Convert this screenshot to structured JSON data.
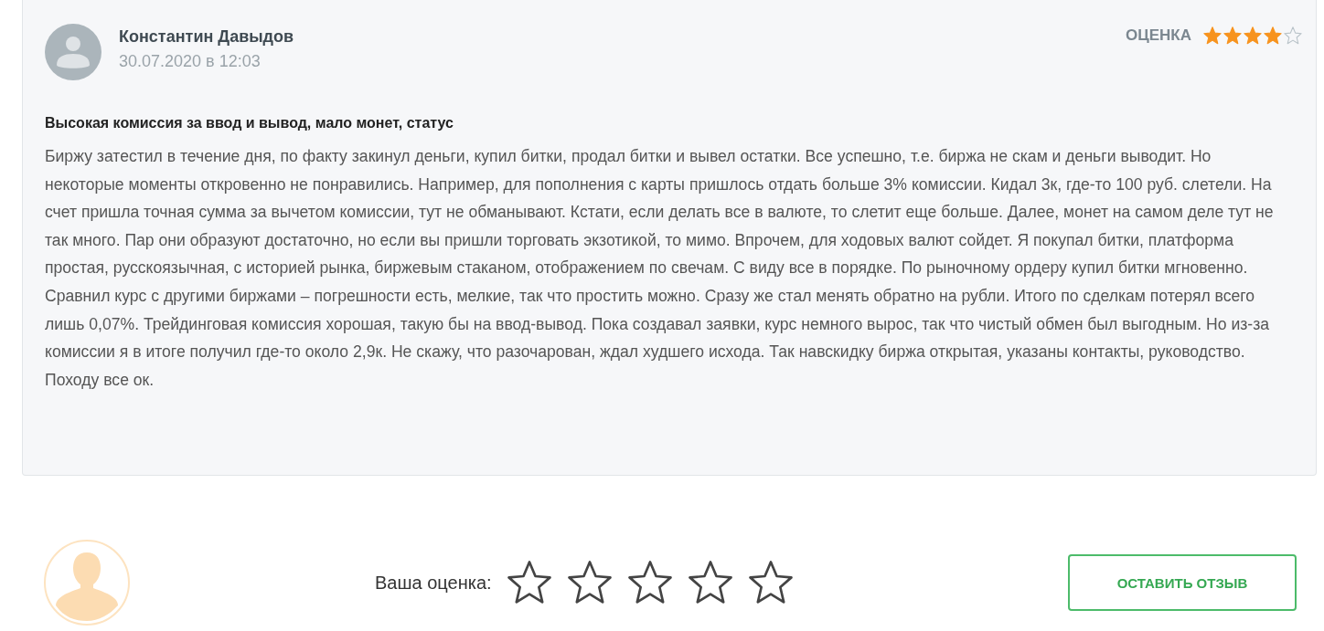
{
  "review": {
    "author": "Константин Давыдов",
    "date": "30.07.2020 в 12:03",
    "rating_label": "ОЦЕНКА",
    "stars": 4,
    "title": "Высокая комиссия за ввод и вывод, мало монет, статус",
    "text": "Биржу затестил в течение дня, по факту закинул деньги, купил битки, продал битки и вывел остатки. Все успешно, т.е. биржа не скам и деньги выводит. Но некоторые моменты откровенно не понравились. Например, для пополнения с карты пришлось отдать больше 3% комиссии. Кидал 3к, где-то 100 руб. слетели. На счет пришла точная сумма за вычетом комиссии, тут не обманывают. Кстати, если делать все в валюте, то слетит еще больше. Далее, монет на самом деле тут не так много. Пар они образуют достаточно, но если вы пришли торговать экзотикой, то мимо. Впрочем, для ходовых валют сойдет. Я покупал битки, платформа простая, русскоязычная, с историей рынка, биржевым стаканом, отображением по свечам. С виду все в порядке. По рыночному ордеру купил битки мгновенно. Сравнил курс с другими биржами – погрешности есть, мелкие, так что простить можно. Сразу же стал менять обратно на рубли. Итого по сделкам потерял всего лишь 0,07%. Трейдинговая комиссия хорошая, такую бы на ввод-вывод. Пока создавал заявки, курс немного вырос, так что чистый обмен был выгодным. Но из-за комиссии я в итоге получил где-то около 2,9к. Не скажу, что разочарован, ждал худшего исхода. Так навскидку биржа открытая, указаны контакты, руководство. Походу все ок."
  },
  "form": {
    "label": "Ваша оценка:",
    "stars": 0,
    "button": "ОСТАВИТЬ ОТЗЫВ"
  }
}
